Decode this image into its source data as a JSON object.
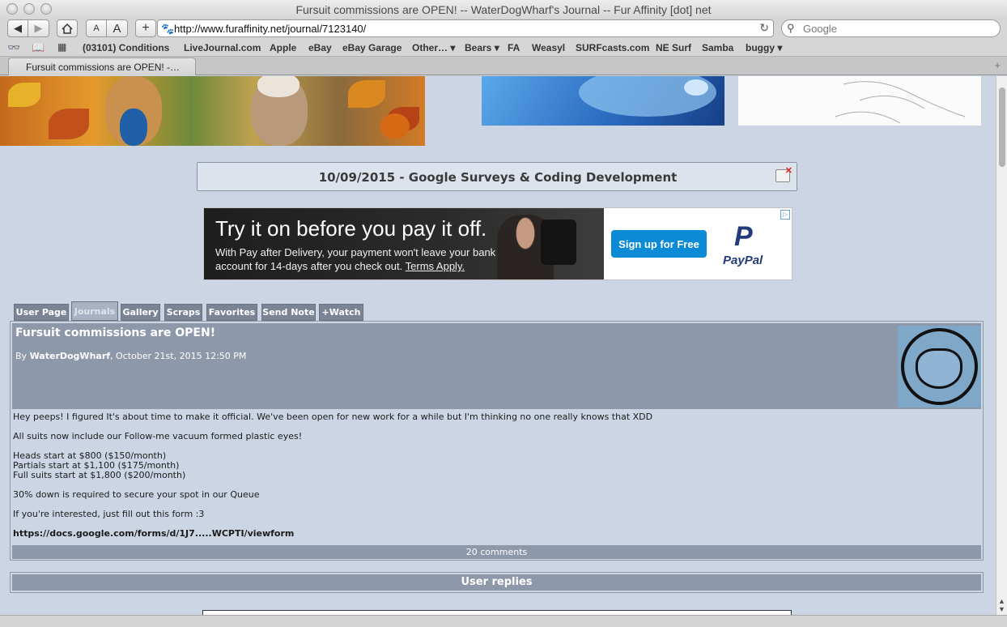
{
  "window": {
    "title": "Fursuit commissions are OPEN! -- WaterDogWharf's Journal -- Fur Affinity [dot] net"
  },
  "toolbar": {
    "back_icon": "back-arrow-icon",
    "forward_icon": "forward-arrow-icon",
    "home_icon": "home-icon",
    "text_smaller": "A",
    "text_larger": "A",
    "add_icon": "plus-icon",
    "url": "http://www.furaffinity.net/journal/7123140/",
    "search_placeholder": "Google"
  },
  "bookmarks": {
    "items": [
      "(03101) Conditions",
      "LiveJournal.com",
      "Apple",
      "eBay",
      "eBay Garage",
      "Other…",
      "Bears",
      "FA",
      "Weasyl",
      "SURFcasts.com",
      "NE Surf",
      "Samba",
      "buggy"
    ]
  },
  "tab": {
    "label": "Fursuit commissions are OPEN! -…"
  },
  "notice": {
    "text": "10/09/2015 - Google Surveys & Coding Development"
  },
  "ad": {
    "headline": "Try it on before you pay it off.",
    "body": "With Pay after Delivery, your payment won't leave your bank account for 14-days after you check out.",
    "terms": "Terms Apply.",
    "button": "Sign up for Free",
    "brand": "PayPal",
    "brand_logo": "P"
  },
  "user_tabs": [
    "User Page",
    "Journals",
    "Gallery",
    "Scraps",
    "Favorites",
    "Send Note",
    "+Watch"
  ],
  "journal": {
    "title": "Fursuit commissions are OPEN!",
    "by_prefix": "By",
    "author": "WaterDogWharf",
    "date": ", October 21st, 2015 12:50 PM",
    "lines": {
      "intro": "Hey peeps! I figured It's about time to make it official. We've been open for new work for a while but I'm thinking no one really knows that XDD",
      "eyes": "All suits now include our Follow-me vacuum formed plastic eyes!",
      "heads": "Heads start at $800 ($150/month)",
      "partials": "Partials start at $1,100 ($175/month)",
      "full": "Full suits start at $1,800 ($200/month)",
      "deposit": "30% down is required to secure your spot in our Queue",
      "form": "If you're interested, just fill out this form :3",
      "link": "https://docs.google.com/forms/d/1J7.....WCPTI/viewform"
    },
    "comments": "20 comments"
  },
  "replies_header": "User replies"
}
